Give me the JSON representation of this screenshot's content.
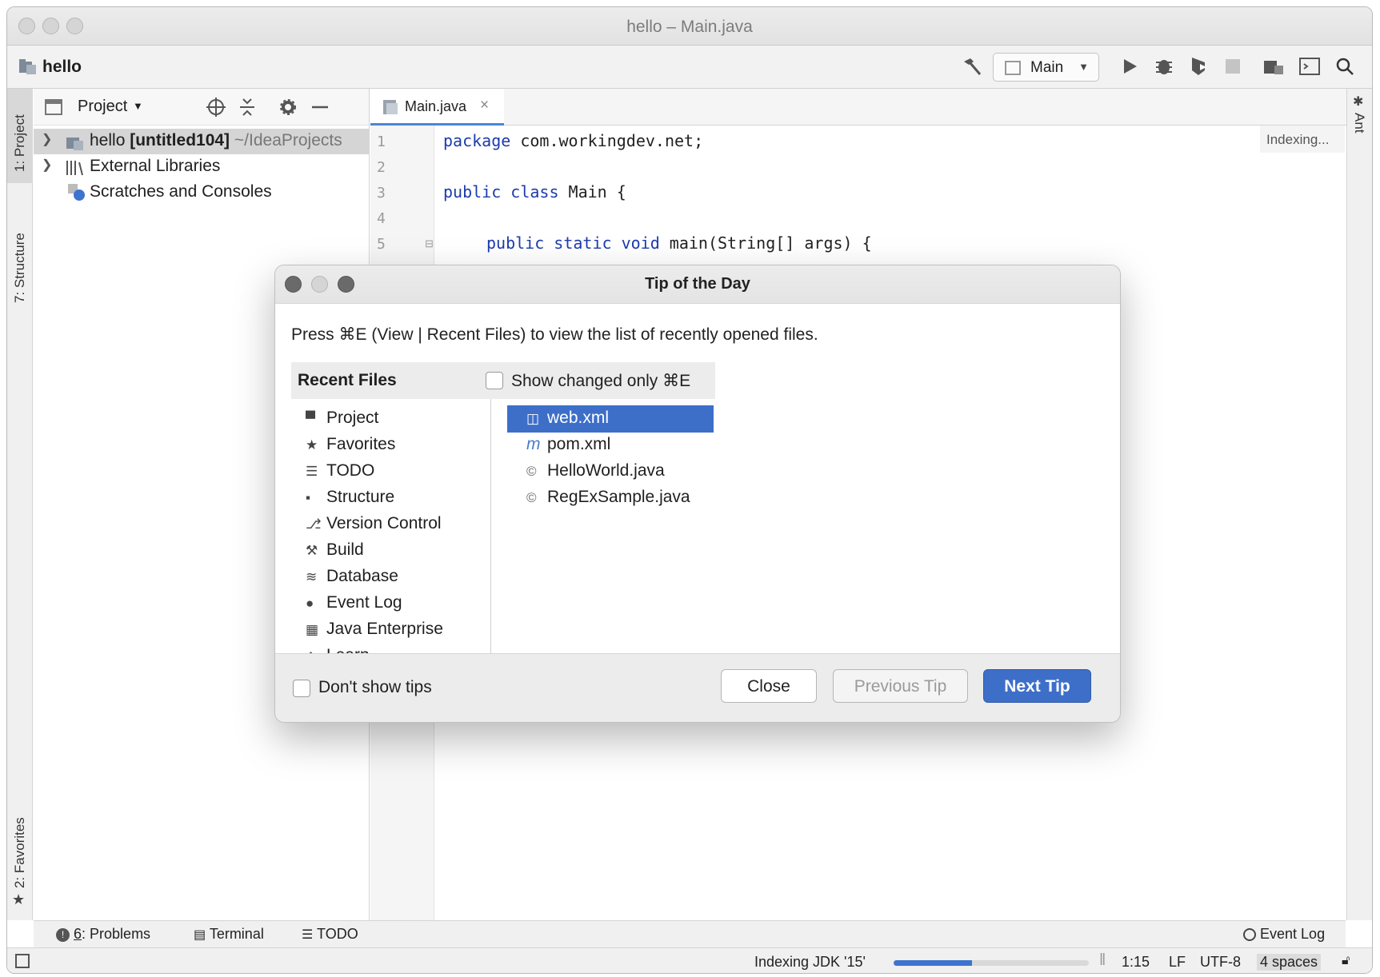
{
  "window": {
    "title": "hello – Main.java"
  },
  "navbar": {
    "project": "hello",
    "run_config": "Main",
    "icons": [
      "hammer-icon",
      "run-icon",
      "debug-icon",
      "coverage-icon",
      "stop-icon",
      "project-structure-icon",
      "terminal-icon",
      "search-icon"
    ]
  },
  "left_stripe": {
    "project_tab": "1: Project",
    "structure_tab": "7: Structure",
    "favorites_tab": "2: Favorites"
  },
  "right_stripe": {
    "ant_tab": "Ant"
  },
  "project_panel": {
    "title": "Project",
    "tree": [
      {
        "name": "hello",
        "bold_suffix": " [untitled104]",
        "path": " ~/IdeaProjects"
      },
      {
        "name": "External Libraries"
      },
      {
        "name": "Scratches and Consoles"
      }
    ]
  },
  "editor": {
    "tab": "Main.java",
    "status": "Indexing...",
    "line_numbers": [
      "1",
      "2",
      "3",
      "4",
      "5"
    ],
    "lines": [
      {
        "kw": "package",
        "rest": " com.workingdev.net;"
      },
      {
        "kw": "",
        "rest": ""
      },
      {
        "kw": "public class",
        "rest": " Main {"
      },
      {
        "kw": "",
        "rest": ""
      },
      {
        "kw": "public static void",
        "rest": " main(String[] args) {"
      }
    ]
  },
  "dialog": {
    "title": "Tip of the Day",
    "tip": "Press ⌘E (View | Recent Files) to view the list of recently opened files.",
    "recent_files_header": "Recent Files",
    "show_changed_label": "Show changed only ⌘E",
    "left_items": [
      {
        "label": "Project",
        "icon": "folder-icon",
        "glyph": "▀"
      },
      {
        "label": "Favorites",
        "icon": "star-icon",
        "glyph": "★"
      },
      {
        "label": "TODO",
        "icon": "list-icon",
        "glyph": "☰"
      },
      {
        "label": "Structure",
        "icon": "structure-icon",
        "glyph": "▪"
      },
      {
        "label": "Version Control",
        "icon": "branch-icon",
        "glyph": "⎇"
      },
      {
        "label": "Build",
        "icon": "hammer-icon",
        "glyph": "⚒"
      },
      {
        "label": "Database",
        "icon": "database-icon",
        "glyph": "≋"
      },
      {
        "label": "Event Log",
        "icon": "event-log-icon",
        "glyph": "●"
      },
      {
        "label": "Java Enterprise",
        "icon": "java-enterprise-icon",
        "glyph": "▦"
      },
      {
        "label": "Learn",
        "icon": "learn-icon",
        "glyph": "◆"
      }
    ],
    "files": [
      {
        "label": "web.xml",
        "icon": "xml-file-icon",
        "glyph": "◫",
        "selected": true
      },
      {
        "label": "pom.xml",
        "icon": "maven-icon",
        "glyph": "m",
        "selected": false
      },
      {
        "label": "HelloWorld.java",
        "icon": "java-class-icon",
        "glyph": "©",
        "selected": false
      },
      {
        "label": "RegExSample.java",
        "icon": "java-class-icon",
        "glyph": "©",
        "selected": false
      }
    ],
    "dont_show_label": "Don't show tips",
    "buttons": {
      "close": "Close",
      "previous": "Previous Tip",
      "next": "Next Tip"
    }
  },
  "bottom_tools": {
    "problems_num": "6",
    "problems": ": Problems",
    "terminal": "Terminal",
    "todo": "TODO",
    "event_log": "Event Log"
  },
  "status_bar": {
    "indexing": "Indexing JDK '15'",
    "progress": 0.4,
    "position": "1:15",
    "line_sep": "LF",
    "encoding": "UTF-8",
    "indent": "4 spaces"
  },
  "colors": {
    "accent": "#3d6fc9",
    "keyword": "#1c3cac"
  }
}
